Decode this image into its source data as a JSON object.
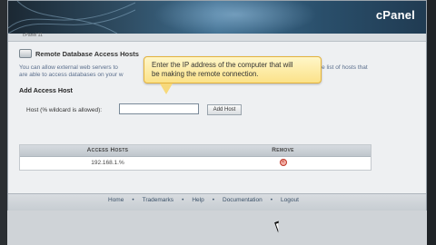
{
  "header": {
    "brand": "cPanel"
  },
  "breadcrumb": {
    "text": "cPanel 11"
  },
  "page": {
    "title": "Remote Database Access Hosts",
    "desc_line1": "You can allow external web servers to",
    "desc_line1_tail": "ame to the list of hosts that",
    "desc_line2": "are able to access databases on your w"
  },
  "add_access": {
    "heading": "Add Access Host",
    "host_label": "Host (% wildcard is allowed):",
    "host_value": "",
    "button": "Add Host"
  },
  "access_table": {
    "columns": [
      "Access Hosts",
      "Remove"
    ],
    "rows": [
      {
        "host": "192.168.1.%"
      }
    ]
  },
  "footer": {
    "links": [
      "Home",
      "Trademarks",
      "Help",
      "Documentation",
      "Logout"
    ]
  },
  "tooltip": {
    "line1": "Enter the IP address of the computer that will",
    "line2": "be making the remote connection."
  },
  "colors": {
    "tooltip_bg": "#fbe289",
    "header": "#2f4d63"
  }
}
